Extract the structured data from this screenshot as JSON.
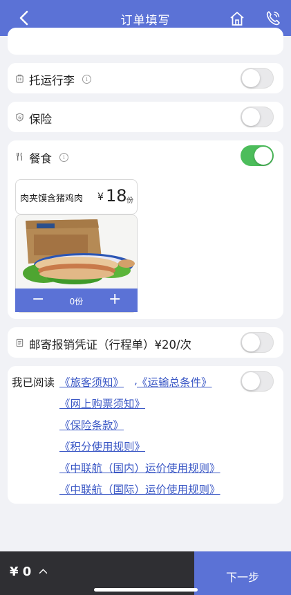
{
  "header": {
    "title": "订单填写"
  },
  "options": {
    "luggage": {
      "label": "托运行李",
      "enabled": false
    },
    "insurance": {
      "label": "保险",
      "enabled": false
    },
    "meal": {
      "label": "餐食",
      "enabled": true
    }
  },
  "meal_item": {
    "name": "肉夹馍含猪鸡肉",
    "currency": "¥",
    "price": "18",
    "unit": "份",
    "quantity": "0份",
    "minus": "−",
    "plus": "+"
  },
  "mail_receipt": {
    "label": "邮寄报销凭证（行程单）¥20/次",
    "enabled": false
  },
  "agreement": {
    "prefix": "我已阅读",
    "links": [
      "《旅客须知》",
      ",",
      "《运输总条件》",
      "《网上购票须知》",
      "《保险条款》",
      "《积分使用规则》",
      "《中联航（国内）运价使用规则》",
      "《中联航（国际）运价使用规则》"
    ],
    "accepted": false
  },
  "footer": {
    "total": "¥ 0",
    "next_label": "下一步"
  },
  "colors": {
    "accent": "#5b72d6",
    "toggle_on": "#4cbd5b",
    "footer_dark": "#2f2f33",
    "link": "#3a57c5"
  },
  "icons": [
    "back-arrow-icon",
    "home-icon",
    "phone-icon",
    "luggage-icon",
    "shield-icon",
    "utensils-icon",
    "info-icon",
    "receipt-icon",
    "chevron-up-icon"
  ]
}
